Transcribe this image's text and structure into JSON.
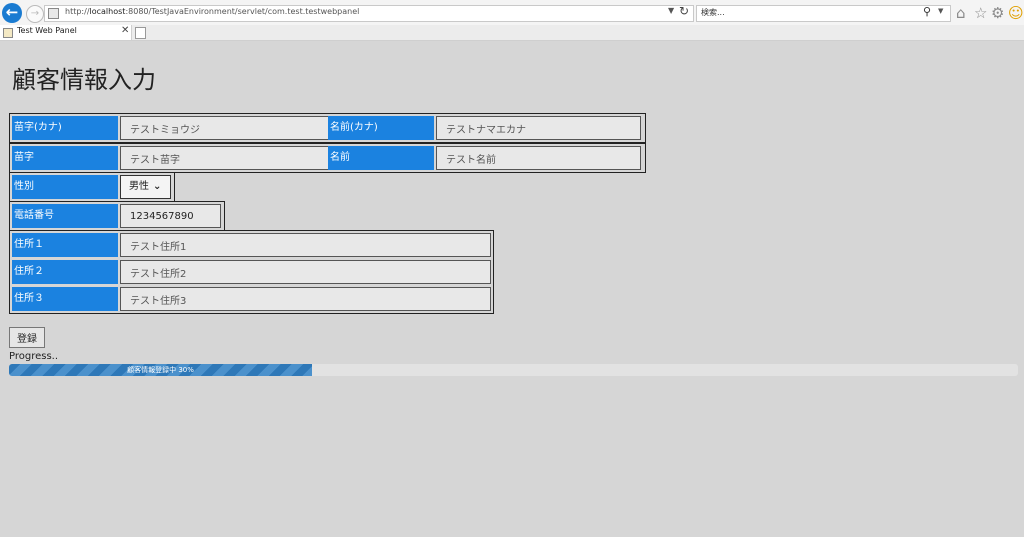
{
  "browser": {
    "url_prefix": "http://",
    "url_host": "localhost",
    "url_rest": ":8080/TestJavaEnvironment/servlet/com.test.testwebpanel",
    "search_placeholder": "検索...",
    "tab_title": "Test Web Panel",
    "icons": [
      "back-arrow-icon",
      "forward-arrow-icon",
      "refresh-icon",
      "search-icon",
      "home-icon",
      "star-icon",
      "gear-icon",
      "smiley-icon"
    ]
  },
  "page": {
    "title": "顧客情報入力"
  },
  "form": {
    "last_kana_label": "苗字(カナ)",
    "last_kana_value": "テストミョウジ",
    "first_kana_label": "名前(カナ)",
    "first_kana_value": "テストナマエカナ",
    "last_label": "苗字",
    "last_value": "テスト苗字",
    "first_label": "名前",
    "first_value": "テスト名前",
    "gender_label": "性別",
    "gender_value": "男性",
    "phone_label": "電話番号",
    "phone_value": "1234567890",
    "addr1_label": "住所１",
    "addr1_value": "テスト住所1",
    "addr2_label": "住所２",
    "addr2_value": "テスト住所2",
    "addr3_label": "住所３",
    "addr3_value": "テスト住所3"
  },
  "actions": {
    "register_label": "登録"
  },
  "progress": {
    "label": "Progress..",
    "text": "顧客情報登録中 30%",
    "percent": 30,
    "color": "#2e78b8"
  },
  "colors": {
    "label_bg": "#1b82e0",
    "page_bg": "#d6d6d6"
  }
}
